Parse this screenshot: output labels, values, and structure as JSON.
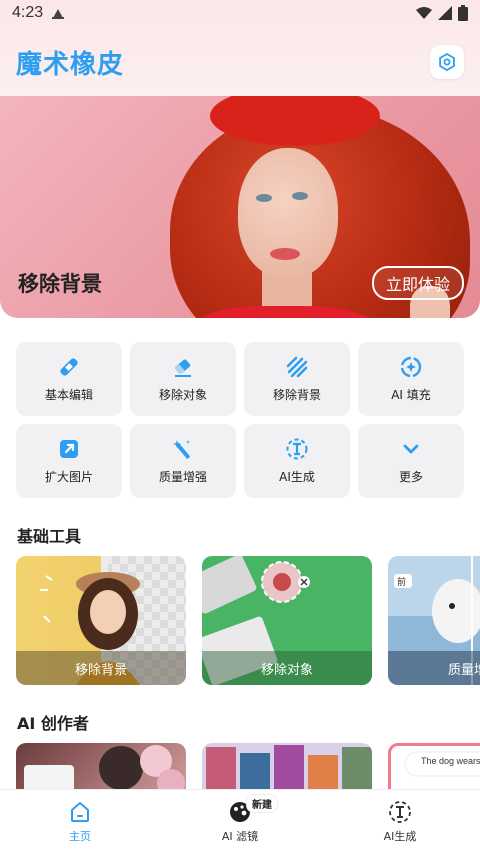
{
  "status_bar": {
    "time": "4:23"
  },
  "header": {
    "title": "魔术橡皮"
  },
  "hero": {
    "label": "移除背景",
    "cta": "立即体验"
  },
  "quick_actions": [
    {
      "label": "基本编辑",
      "icon": "bandage-icon"
    },
    {
      "label": "移除对象",
      "icon": "eraser-icon"
    },
    {
      "label": "移除背景",
      "icon": "stripes-icon"
    },
    {
      "label": "AI 填充",
      "icon": "sparkle-fill-icon"
    },
    {
      "label": "扩大图片",
      "icon": "expand-image-icon"
    },
    {
      "label": "质量增强",
      "icon": "magic-wand-icon"
    },
    {
      "label": "AI生成",
      "icon": "text-cursor-icon"
    },
    {
      "label": "更多",
      "icon": "chevron-down-icon"
    }
  ],
  "sections": {
    "basic_tools": "基础工具",
    "ai_creator": "AI 创作者"
  },
  "tool_cards": [
    {
      "label": "移除背景"
    },
    {
      "label": "移除对象"
    },
    {
      "label": "质量增",
      "tag": "前"
    }
  ],
  "ai_cards": [
    {
      "label": ""
    },
    {
      "label": ""
    },
    {
      "label": "The dog wears"
    }
  ],
  "bottom_nav": [
    {
      "label": "主页",
      "icon": "home-icon"
    },
    {
      "label": "AI 滤镜",
      "icon": "palette-icon",
      "badge": "新建"
    },
    {
      "label": "AI生成",
      "icon": "text-cursor-icon"
    }
  ],
  "colors": {
    "accent": "#2d9ef0",
    "hero_bg": "#ea98a2",
    "tile_bg": "#f1f1f3"
  }
}
